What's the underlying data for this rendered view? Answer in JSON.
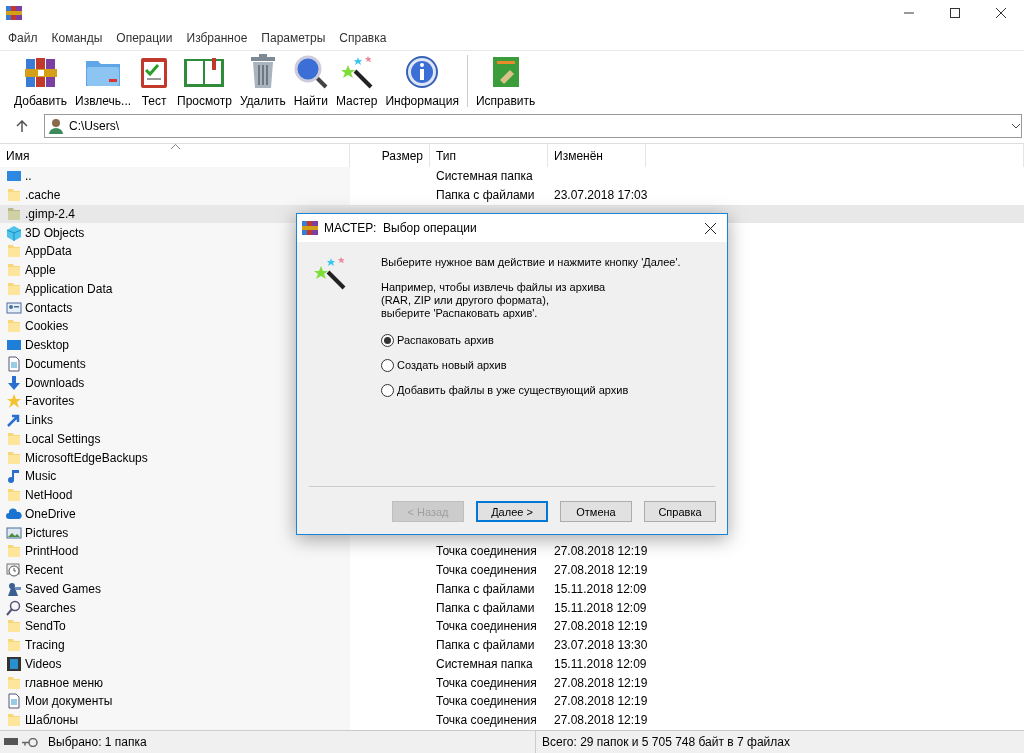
{
  "menu": [
    "Файл",
    "Команды",
    "Операции",
    "Избранное",
    "Параметры",
    "Справка"
  ],
  "toolbar": [
    {
      "label": "Добавить",
      "kind": "archive"
    },
    {
      "label": "Извлечь...",
      "kind": "folder"
    },
    {
      "label": "Тест",
      "kind": "clipboard"
    },
    {
      "label": "Просмотр",
      "kind": "book"
    },
    {
      "label": "Удалить",
      "kind": "trash"
    },
    {
      "label": "Найти",
      "kind": "magnifier"
    },
    {
      "label": "Мастер",
      "kind": "wand"
    },
    {
      "label": "Информация",
      "kind": "info"
    },
    {
      "label": "Исправить",
      "kind": "repair"
    }
  ],
  "address": {
    "value": "C:\\Users\\"
  },
  "table": {
    "columns": [
      "Имя",
      "Размер",
      "Тип",
      "Изменён"
    ],
    "rows": [
      {
        "name": "..",
        "kind": "up",
        "type": "Системная папка",
        "selected": false
      },
      {
        "name": ".cache",
        "kind": "folder",
        "type": "Папка с файлами",
        "modified": "23.07.2018 17:03",
        "selected": false
      },
      {
        "name": ".gimp-2.4",
        "kind": "folder-grey",
        "selected": true
      },
      {
        "name": "3D Objects",
        "kind": "cube",
        "selected": false
      },
      {
        "name": "AppData",
        "kind": "folder",
        "selected": false
      },
      {
        "name": "Apple",
        "kind": "folder",
        "selected": false
      },
      {
        "name": "Application Data",
        "kind": "folder",
        "selected": false
      },
      {
        "name": "Contacts",
        "kind": "contacts",
        "selected": false
      },
      {
        "name": "Cookies",
        "kind": "folder",
        "selected": false
      },
      {
        "name": "Desktop",
        "kind": "desktop",
        "selected": false
      },
      {
        "name": "Documents",
        "kind": "document",
        "selected": false
      },
      {
        "name": "Downloads",
        "kind": "download",
        "selected": false
      },
      {
        "name": "Favorites",
        "kind": "star",
        "selected": false
      },
      {
        "name": "Links",
        "kind": "link",
        "selected": false
      },
      {
        "name": "Local Settings",
        "kind": "folder",
        "selected": false
      },
      {
        "name": "MicrosoftEdgeBackups",
        "kind": "folder",
        "selected": false
      },
      {
        "name": "Music",
        "kind": "music",
        "selected": false
      },
      {
        "name": "NetHood",
        "kind": "folder",
        "selected": false
      },
      {
        "name": "OneDrive",
        "kind": "cloud",
        "selected": false
      },
      {
        "name": "Pictures",
        "kind": "picture",
        "selected": false
      },
      {
        "name": "PrintHood",
        "kind": "folder",
        "type": "Точка соединения",
        "modified": "27.08.2018 12:19",
        "selected": false
      },
      {
        "name": "Recent",
        "kind": "recent",
        "type": "Точка соединения",
        "modified": "27.08.2018 12:19",
        "selected": false
      },
      {
        "name": "Saved Games",
        "kind": "games",
        "type": "Папка с файлами",
        "modified": "15.11.2018 12:09",
        "selected": false
      },
      {
        "name": "Searches",
        "kind": "search",
        "type": "Папка с файлами",
        "modified": "15.11.2018 12:09",
        "selected": false
      },
      {
        "name": "SendTo",
        "kind": "folder",
        "type": "Точка соединения",
        "modified": "27.08.2018 12:19",
        "selected": false
      },
      {
        "name": "Tracing",
        "kind": "folder",
        "type": "Папка с файлами",
        "modified": "23.07.2018 13:30",
        "selected": false
      },
      {
        "name": "Videos",
        "kind": "video",
        "type": "Системная папка",
        "modified": "15.11.2018 12:09",
        "selected": false
      },
      {
        "name": "главное меню",
        "kind": "folder",
        "type": "Точка соединения",
        "modified": "27.08.2018 12:19",
        "selected": false
      },
      {
        "name": "Мои документы",
        "kind": "document",
        "type": "Точка соединения",
        "modified": "27.08.2018 12:19",
        "selected": false
      },
      {
        "name": "Шаблоны",
        "kind": "folder",
        "type": "Точка соединения",
        "modified": "27.08.2018 12:19",
        "selected": false
      }
    ]
  },
  "status_bar": {
    "left": "Выбрано: 1 папка",
    "right": "Всего: 29 папок и 5 705 748 байт в 7 файлах"
  },
  "dialog": {
    "title": "МАСТЕР:  Выбор операции",
    "intro": "Выберите нужное вам действие и нажмите кнопку 'Далее'.",
    "hint": "Например, чтобы извлечь файлы из архива\n(RAR, ZIP или другого формата),\nвыберите 'Распаковать архив'.",
    "options": [
      {
        "label": "Распаковать архив",
        "selected": true
      },
      {
        "label": "Создать новый архив",
        "selected": false
      },
      {
        "label": "Добавить файлы в уже существующий архив",
        "selected": false
      }
    ],
    "buttons": [
      {
        "label": "< Назад",
        "disabled": true,
        "default": false
      },
      {
        "label": "Далее >",
        "disabled": false,
        "default": true
      },
      {
        "label": "Отмена",
        "disabled": false,
        "default": false
      },
      {
        "label": "Справка",
        "disabled": false,
        "default": false
      }
    ]
  }
}
